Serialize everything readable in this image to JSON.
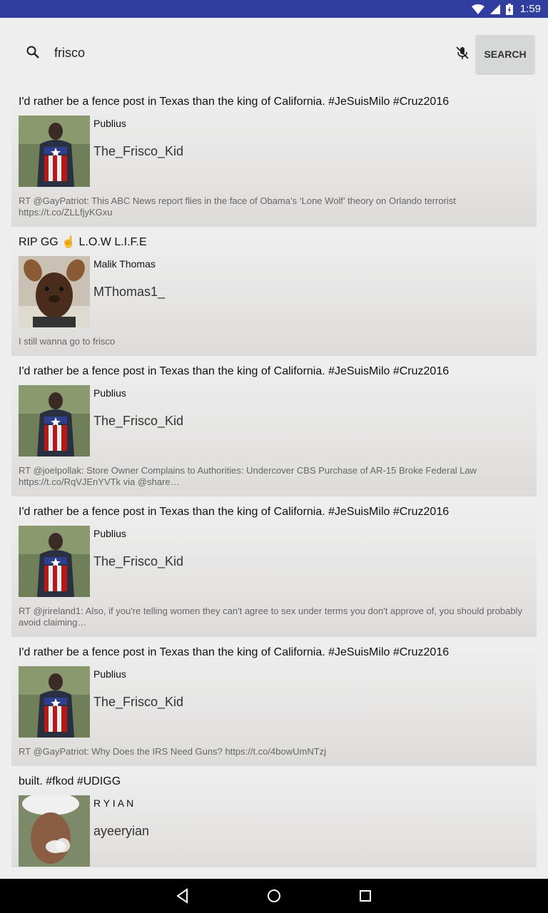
{
  "status_bar": {
    "time": "1:59"
  },
  "search": {
    "query": "frisco",
    "button_label": "SEARCH"
  },
  "results": [
    {
      "title": "I'd rather be a fence post in Texas than the king of California. #JeSuisMilo #Cruz2016",
      "name": "Publius",
      "handle": "The_Frisco_Kid",
      "text": "RT @GayPatriot: This ABC News report flies in the face of Obama’s ‘Lone Wolf’ theory on Orlando terrorist  https://t.co/ZLLfjyKGxu",
      "avatar": "captain-america-back"
    },
    {
      "title": "RIP GG ☝️ L.O.W L.I.F.E",
      "name": "Malik Thomas",
      "handle": "MThomas1_",
      "text": "I still wanna go to frisco",
      "avatar": "dog-filter-selfie"
    },
    {
      "title": "I'd rather be a fence post in Texas than the king of California. #JeSuisMilo #Cruz2016",
      "name": "Publius",
      "handle": "The_Frisco_Kid",
      "text": "RT @joelpollak: Store Owner Complains to Authorities: Undercover CBS Purchase of AR-15 Broke Federal Law https://t.co/RqVJEnYVTk via @share…",
      "avatar": "captain-america-back"
    },
    {
      "title": "I'd rather be a fence post in Texas than the king of California. #JeSuisMilo #Cruz2016",
      "name": "Publius",
      "handle": "The_Frisco_Kid",
      "text": "RT @jrireland1: Also, if you're telling women they can't agree to sex under terms you don't approve of, you should probably avoid claiming…",
      "avatar": "captain-america-back"
    },
    {
      "title": "I'd rather be a fence post in Texas than the king of California. #JeSuisMilo #Cruz2016",
      "name": "Publius",
      "handle": "The_Frisco_Kid",
      "text": "RT @GayPatriot: Why Does the IRS Need Guns? https://t.co/4bowUmNTzj",
      "avatar": "captain-america-back"
    },
    {
      "title": "built. #fkod #UDIGG",
      "name": "R Y I A N",
      "handle": "ayeeryian",
      "text": "",
      "avatar": "smoke-selfie"
    }
  ]
}
